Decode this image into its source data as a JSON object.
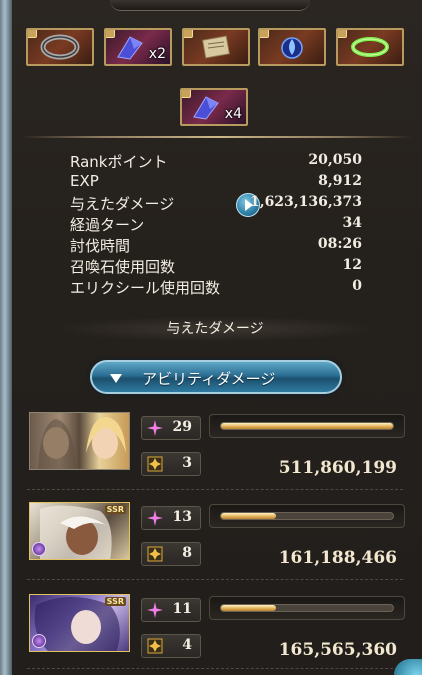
{
  "header": {
    "items": [
      {
        "icon": "ring-icon",
        "qty": ""
      },
      {
        "icon": "blue-crystal-icon",
        "qty": "x2"
      },
      {
        "icon": "scroll-icon",
        "qty": ""
      },
      {
        "icon": "blue-flame-orb-icon",
        "qty": ""
      },
      {
        "icon": "green-halo-icon",
        "qty": ""
      },
      {
        "icon": "blue-crystal-icon",
        "qty": "x4"
      }
    ]
  },
  "stats": [
    {
      "label": "Rankポイント",
      "value": "20,050"
    },
    {
      "label": "EXP",
      "value": "8,912"
    },
    {
      "label": "与えたダメージ",
      "value": "1,623,136,373"
    },
    {
      "label": "経過ターン",
      "value": "34"
    },
    {
      "label": "討伐時間",
      "value": "08:26"
    },
    {
      "label": "召喚石使用回数",
      "value": "12"
    },
    {
      "label": "エリクシール使用回数",
      "value": "0"
    }
  ],
  "section": {
    "title": "与えたダメージ"
  },
  "ability_button": {
    "label": "アビリティダメージ"
  },
  "characters": [
    {
      "hits": "29",
      "ability": "3",
      "damage": "511,860,199",
      "fill": 1.0,
      "ssr": ""
    },
    {
      "hits": "13",
      "ability": "8",
      "damage": "161,188,466",
      "fill": 0.32,
      "ssr": "SSR"
    },
    {
      "hits": "11",
      "ability": "4",
      "damage": "165,565,360",
      "fill": 0.32,
      "ssr": "SSR"
    }
  ],
  "colors": {
    "gold": "#e0ae55",
    "accent_blue": "#2b6e93",
    "panel": "#24201c"
  }
}
